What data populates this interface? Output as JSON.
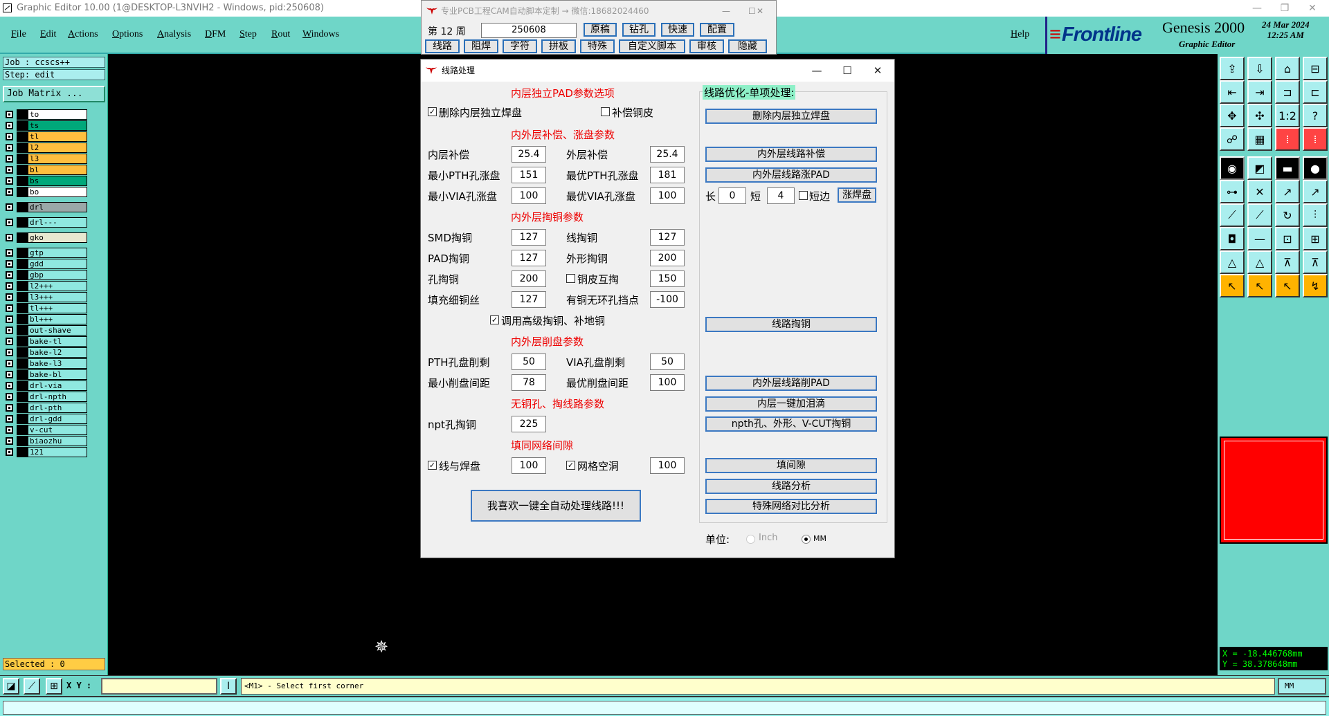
{
  "titlebar": {
    "title": "Graphic Editor 10.00 (1@DESKTOP-L3NVIH2 - Windows, pid:250608)"
  },
  "menu": [
    "File",
    "Edit",
    "Actions",
    "Options",
    "Analysis",
    "DFM",
    "Step",
    "Rout",
    "Windows"
  ],
  "help": "Help",
  "logo": {
    "frontline": "Frontline",
    "genesis": "Genesis 2000",
    "editor": "Graphic Editor",
    "date": "24 Mar 2024",
    "time": "12:25 AM"
  },
  "job": {
    "job_label": "Job  : ccscs++",
    "step_label": "Step: edit",
    "job_matrix": "Job Matrix ..."
  },
  "layers": [
    {
      "name": "to",
      "color": "#ffffff"
    },
    {
      "name": "ts",
      "color": "#00a87a"
    },
    {
      "name": "tl",
      "color": "#ffbf3f"
    },
    {
      "name": "l2",
      "color": "#ffbf3f"
    },
    {
      "name": "l3",
      "color": "#ffbf3f"
    },
    {
      "name": "bl",
      "color": "#ffbf3f"
    },
    {
      "name": "bs",
      "color": "#00a87a"
    },
    {
      "name": "bo",
      "color": "#ffffff"
    },
    {
      "name": "drl",
      "color": "#9aa8a8"
    },
    {
      "name": "drl---",
      "color": "#8fe8e0"
    },
    {
      "name": "gko",
      "color": "#e8e8d0"
    },
    {
      "name": "gtp",
      "color": "#8fe8e0"
    },
    {
      "name": "gdd",
      "color": "#8fe8e0"
    },
    {
      "name": "gbp",
      "color": "#8fe8e0"
    },
    {
      "name": "l2+++",
      "color": "#8fe8e0"
    },
    {
      "name": "l3+++",
      "color": "#8fe8e0"
    },
    {
      "name": "tl+++",
      "color": "#8fe8e0"
    },
    {
      "name": "bl+++",
      "color": "#8fe8e0"
    },
    {
      "name": "out-shave",
      "color": "#8fe8e0"
    },
    {
      "name": "bake-tl",
      "color": "#8fe8e0"
    },
    {
      "name": "bake-l2",
      "color": "#8fe8e0"
    },
    {
      "name": "bake-l3",
      "color": "#8fe8e0"
    },
    {
      "name": "bake-bl",
      "color": "#8fe8e0"
    },
    {
      "name": "drl-via",
      "color": "#8fe8e0"
    },
    {
      "name": "drl-npth",
      "color": "#8fe8e0"
    },
    {
      "name": "drl-pth",
      "color": "#8fe8e0"
    },
    {
      "name": "drl-gdd",
      "color": "#8fe8e0"
    },
    {
      "name": "v-cut",
      "color": "#8fe8e0"
    },
    {
      "name": "biaozhu",
      "color": "#8fe8e0"
    },
    {
      "name": "121",
      "color": "#8fe8e0"
    }
  ],
  "selected": "Selected : 0",
  "coords": {
    "x": "X = -18.446768mm",
    "y": "Y =  38.378648mm"
  },
  "status": {
    "xy_label": "X Y :",
    "prompt": "<M1> - Select first corner",
    "units": "MM"
  },
  "camwin": {
    "title": "专业PCB工程CAM自动脚本定制  → 微信:18682024460",
    "week_prefix": "第 12 周",
    "week_value": "250608",
    "row1": [
      "原稿",
      "钻孔",
      "快速",
      "配置"
    ],
    "row2": [
      "线路",
      "阻焊",
      "字符",
      "拼板",
      "特殊",
      "自定义脚本",
      "审核",
      "隐藏"
    ]
  },
  "dialog": {
    "title": "线路处理",
    "sec1": "内层独立PAD参数选项",
    "del_pad": "删除内层独立焊盘",
    "comp_copper": "补偿铜皮",
    "sec2": "内外层补偿、涨盘参数",
    "inner_comp": "内层补偿",
    "inner_comp_v": "25.4",
    "outer_comp": "外层补偿",
    "outer_comp_v": "25.4",
    "min_pth": "最小PTH孔涨盘",
    "min_pth_v": "151",
    "opt_pth": "最优PTH孔涨盘",
    "opt_pth_v": "181",
    "min_via": "最小VIA孔涨盘",
    "min_via_v": "100",
    "opt_via": "最优VIA孔涨盘",
    "opt_via_v": "100",
    "sec3": "内外层掏铜参数",
    "smd": "SMD掏铜",
    "smd_v": "127",
    "line": "线掏铜",
    "line_v": "127",
    "pad": "PAD掏铜",
    "pad_v": "127",
    "outline": "外形掏铜",
    "outline_v": "200",
    "hole": "孔掏铜",
    "hole_v": "200",
    "cu_mutual": "铜皮互掏",
    "cu_mutual_v": "150",
    "fill_thin": "填充细铜丝",
    "fill_thin_v": "127",
    "ringless": "有铜无环孔挡点",
    "ringless_v": "-100",
    "advanced": "调用高级掏铜、补地铜",
    "sec4": "内外层削盘参数",
    "pth_shave": "PTH孔盘削剩",
    "pth_shave_v": "50",
    "via_shave": "VIA孔盘削剩",
    "via_shave_v": "50",
    "min_gap": "最小削盘间距",
    "min_gap_v": "78",
    "opt_gap": "最优削盘间距",
    "opt_gap_v": "100",
    "sec5": "无铜孔、掏线路参数",
    "npt": "npt孔掏铜",
    "npt_v": "225",
    "sec6": "填同网络间隙",
    "line_pad": "线与焊盘",
    "line_pad_v": "100",
    "grid_void": "网格空洞",
    "grid_void_v": "100",
    "big_button": "我喜欢一键全自动处理线路!!!",
    "opt_title": "线路优化-单项处理:",
    "btn_del_pad": "删除内层独立焊盘",
    "btn_comp": "内外层线路补偿",
    "btn_pad": "内外层线路涨PAD",
    "len_label": "长",
    "len_v": "0",
    "short_label": "短",
    "short_v": "4",
    "short_edge": "短边",
    "btn_grow": "涨焊盘",
    "btn_taotong": "线路掏铜",
    "btn_shave": "内外层线路削PAD",
    "btn_teardrop": "内层一键加泪滴",
    "btn_npth": "npth孔、外形、V-CUT掏铜",
    "btn_fill": "填间隙",
    "btn_analysis": "线路分析",
    "btn_special": "特殊网络对比分析",
    "unit_label": "单位:",
    "unit_inch": "Inch",
    "unit_mm": "MM"
  }
}
